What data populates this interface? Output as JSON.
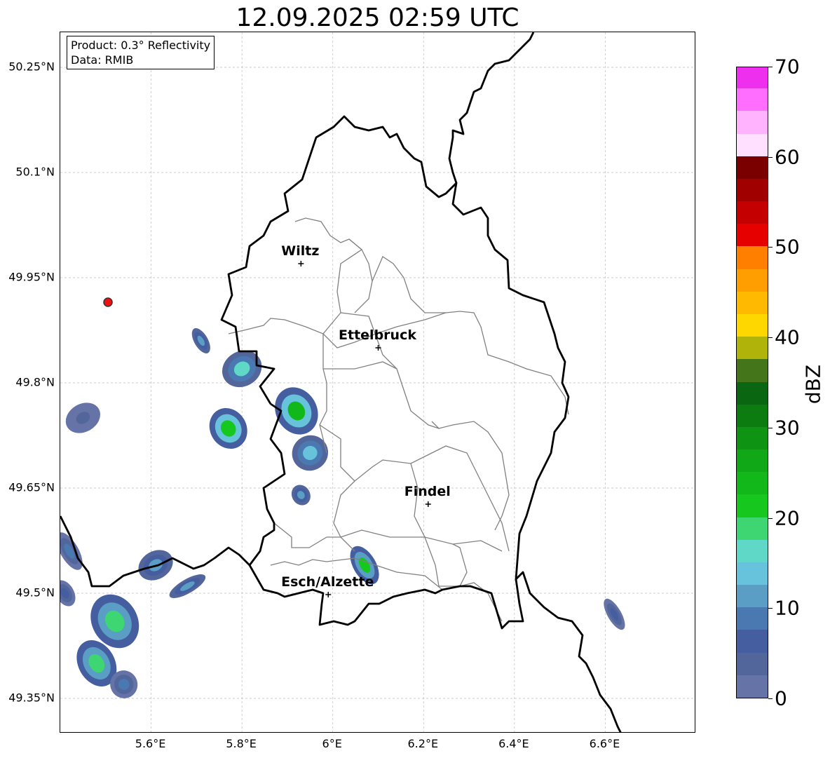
{
  "title": "12.09.2025 02:59 UTC",
  "info": {
    "product": "Product: 0.3° Reflectivity",
    "data": "Data: RMIB"
  },
  "axes": {
    "lat_ticks": [
      {
        "value": 50.25,
        "label": "50.25°N"
      },
      {
        "value": 50.1,
        "label": "50.1°N"
      },
      {
        "value": 49.95,
        "label": "49.95°N"
      },
      {
        "value": 49.8,
        "label": "49.8°N"
      },
      {
        "value": 49.65,
        "label": "49.65°N"
      },
      {
        "value": 49.5,
        "label": "49.5°N"
      },
      {
        "value": 49.35,
        "label": "49.35°N"
      }
    ],
    "lon_ticks": [
      {
        "value": 5.6,
        "label": "5.6°E"
      },
      {
        "value": 5.8,
        "label": "5.8°E"
      },
      {
        "value": 6.0,
        "label": "6°E"
      },
      {
        "value": 6.2,
        "label": "6.2°E"
      },
      {
        "value": 6.4,
        "label": "6.4°E"
      },
      {
        "value": 6.6,
        "label": "6.6°E"
      }
    ],
    "lon_range": [
      5.4,
      6.8
    ],
    "lat_range": [
      49.3,
      50.3
    ],
    "grid": true
  },
  "cities": [
    {
      "name": "Wiltz",
      "lon": 5.93,
      "lat": 49.97
    },
    {
      "name": "Ettelbruck",
      "lon": 6.1,
      "lat": 49.85
    },
    {
      "name": "Findel",
      "lon": 6.21,
      "lat": 49.627
    },
    {
      "name": "Esch/Alzette",
      "lon": 5.99,
      "lat": 49.498
    }
  ],
  "radar_site": {
    "lon": 5.505,
    "lat": 49.915
  },
  "colorbar": {
    "unit": "dBZ",
    "min": 0,
    "max": 70,
    "ticks": [
      {
        "value": 0,
        "label": "0"
      },
      {
        "value": 10,
        "label": "10"
      },
      {
        "value": 20,
        "label": "20"
      },
      {
        "value": 30,
        "label": "30"
      },
      {
        "value": 40,
        "label": "40"
      },
      {
        "value": 50,
        "label": "50"
      },
      {
        "value": 60,
        "label": "60"
      },
      {
        "value": 70,
        "label": "70"
      }
    ],
    "colors": [
      "#6573a6",
      "#52669c",
      "#445ea0",
      "#4979b0",
      "#5a9ec5",
      "#67c2db",
      "#60d8c8",
      "#3ed672",
      "#16c81e",
      "#12b81a",
      "#10a816",
      "#0e9412",
      "#0c7c10",
      "#0a6610",
      "#45751a",
      "#b0b30a",
      "#ffd700",
      "#ffba00",
      "#ff9e00",
      "#ff7f00",
      "#e60000",
      "#c40000",
      "#a00000",
      "#7a0000",
      "#ffe0ff",
      "#ffb3ff",
      "#ff6eff",
      "#ee30ee"
    ]
  },
  "echoes": [
    {
      "lon": 5.77,
      "lat": 49.735,
      "rlon": 0.04,
      "rlat": 0.03,
      "dbz": 22
    },
    {
      "lon": 5.92,
      "lat": 49.76,
      "rlon": 0.045,
      "rlat": 0.035,
      "dbz": 24
    },
    {
      "lon": 5.95,
      "lat": 49.7,
      "rlon": 0.04,
      "rlat": 0.025,
      "dbz": 14
    },
    {
      "lon": 5.8,
      "lat": 49.82,
      "rlon": 0.045,
      "rlat": 0.025,
      "dbz": 15
    },
    {
      "lon": 5.71,
      "lat": 49.86,
      "rlon": 0.015,
      "rlat": 0.02,
      "dbz": 10
    },
    {
      "lon": 5.93,
      "lat": 49.64,
      "rlon": 0.02,
      "rlat": 0.015,
      "dbz": 12
    },
    {
      "lon": 6.07,
      "lat": 49.54,
      "rlon": 0.025,
      "rlat": 0.03,
      "dbz": 20
    },
    {
      "lon": 5.61,
      "lat": 49.54,
      "rlon": 0.04,
      "rlat": 0.02,
      "dbz": 12
    },
    {
      "lon": 5.68,
      "lat": 49.51,
      "rlon": 0.045,
      "rlat": 0.01,
      "dbz": 10
    },
    {
      "lon": 5.52,
      "lat": 49.46,
      "rlon": 0.05,
      "rlat": 0.04,
      "dbz": 18
    },
    {
      "lon": 5.48,
      "lat": 49.4,
      "rlon": 0.04,
      "rlat": 0.035,
      "dbz": 18
    },
    {
      "lon": 5.54,
      "lat": 49.37,
      "rlon": 0.03,
      "rlat": 0.02,
      "dbz": 8
    },
    {
      "lon": 5.42,
      "lat": 49.56,
      "rlon": 0.02,
      "rlat": 0.03,
      "dbz": 8
    },
    {
      "lon": 5.41,
      "lat": 49.5,
      "rlon": 0.02,
      "rlat": 0.02,
      "dbz": 6
    },
    {
      "lon": 6.62,
      "lat": 49.47,
      "rlon": 0.015,
      "rlat": 0.025,
      "dbz": 5
    },
    {
      "lon": 5.45,
      "lat": 49.75,
      "rlon": 0.04,
      "rlat": 0.02,
      "dbz": 4
    }
  ]
}
